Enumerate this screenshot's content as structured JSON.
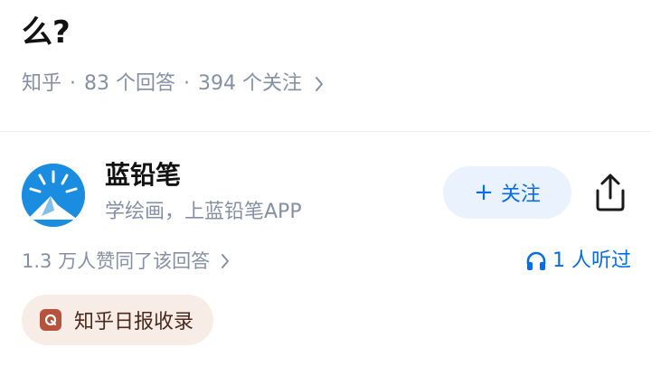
{
  "question": {
    "title_tail": "么?",
    "source": "知乎",
    "separator": "·",
    "answers": "83 个回答",
    "followers": "394 个关注"
  },
  "author": {
    "name": "蓝铅笔",
    "bio": "学绘画，上蓝铅笔APP",
    "follow_plus": "+",
    "follow_label": "关注",
    "avatar_icon": "pencil-logo-icon"
  },
  "stats": {
    "likes": "1.3 万人赞同了该回答",
    "listen": "1 人听过"
  },
  "badge": {
    "label": "知乎日报收录"
  },
  "colors": {
    "accent": "#056de8",
    "meta_gray": "#8590a6",
    "follow_bg": "#eaf2fe",
    "badge_bg": "#f8ece7",
    "badge_logo": "#b5533c",
    "avatar_bg": "#1a8de0"
  }
}
